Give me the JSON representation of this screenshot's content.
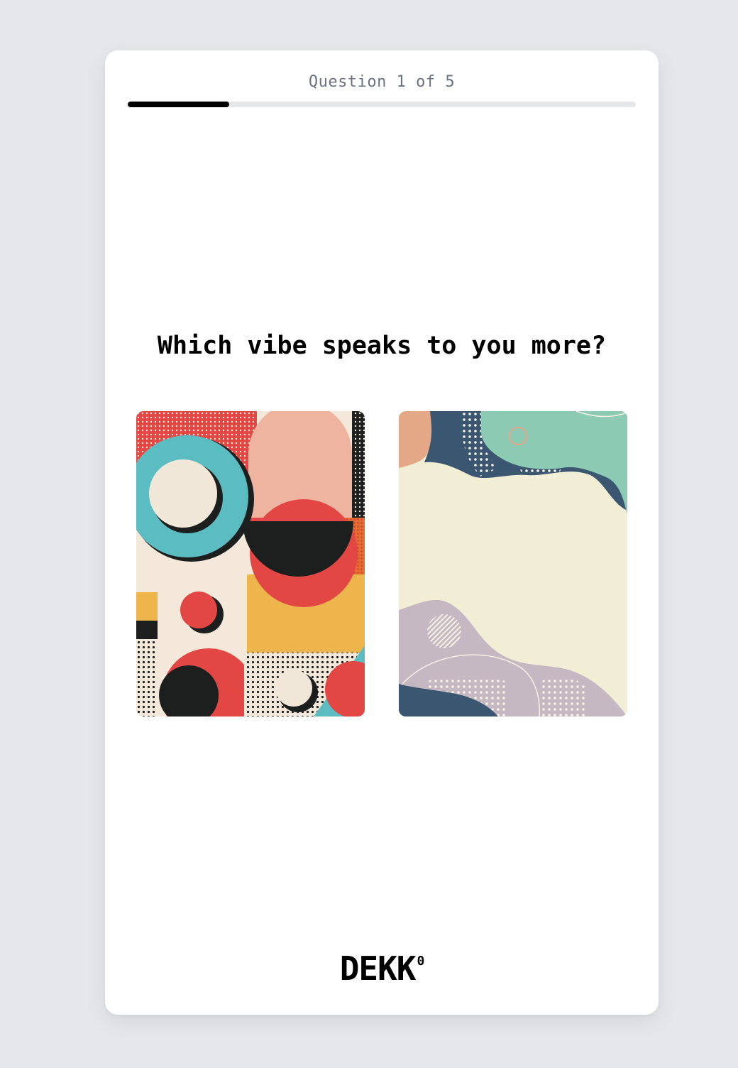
{
  "quiz": {
    "counter": "Question 1 of 5",
    "progress_fraction": 0.2,
    "question": "Which vibe speaks to you more?"
  },
  "options": [
    {
      "name": "geometric-pop-art-option",
      "palette": [
        "#e34744",
        "#5bbcc1",
        "#f1e7d9",
        "#efb4a0",
        "#eeb54c",
        "#1d1f1f"
      ]
    },
    {
      "name": "pastel-organic-option",
      "palette": [
        "#3b5670",
        "#8ccab4",
        "#f2eed5",
        "#e4a886",
        "#c6b8c3"
      ]
    }
  ],
  "brand": {
    "logo_text": "DEKK",
    "logo_superscript": "0"
  },
  "colors": {
    "background": "#e5e7eb",
    "card": "#ffffff",
    "progress_fill": "#000000",
    "progress_track": "#e5e7eb",
    "counter_text": "#6b7280"
  }
}
